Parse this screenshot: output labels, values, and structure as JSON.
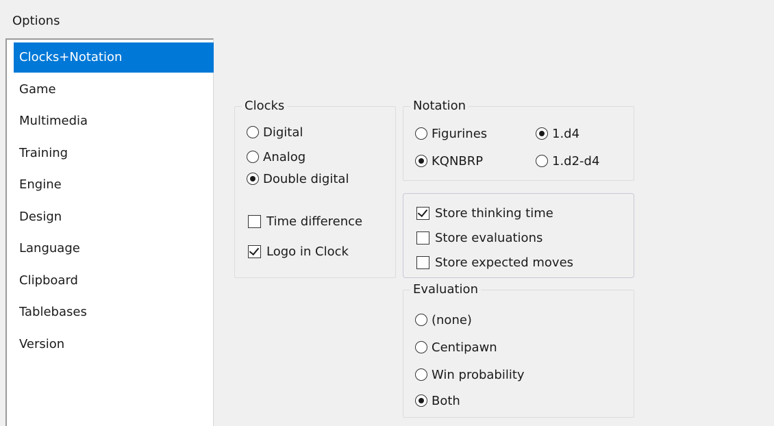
{
  "window": {
    "title": "Options"
  },
  "sidebar": {
    "items": [
      {
        "label": "Clocks+Notation",
        "selected": true
      },
      {
        "label": "Game",
        "selected": false
      },
      {
        "label": "Multimedia",
        "selected": false
      },
      {
        "label": "Training",
        "selected": false
      },
      {
        "label": "Engine",
        "selected": false
      },
      {
        "label": "Design",
        "selected": false
      },
      {
        "label": "Language",
        "selected": false
      },
      {
        "label": "Clipboard",
        "selected": false
      },
      {
        "label": "Tablebases",
        "selected": false
      },
      {
        "label": "Version",
        "selected": false
      }
    ]
  },
  "clocks": {
    "legend": "Clocks",
    "digital": {
      "label": "Digital",
      "checked": false
    },
    "analog": {
      "label": "Analog",
      "checked": false
    },
    "double_digital": {
      "label": "Double digital",
      "checked": true
    },
    "time_difference": {
      "label": "Time difference",
      "checked": false
    },
    "logo_in_clock": {
      "label": "Logo in Clock",
      "checked": true
    }
  },
  "notation": {
    "legend": "Notation",
    "figurines": {
      "label": "Figurines",
      "checked": false
    },
    "kqnbrp": {
      "label": "KQNBRP",
      "checked": true
    },
    "short": {
      "label": "1.d4",
      "checked": true
    },
    "long": {
      "label": "1.d2-d4",
      "checked": false
    }
  },
  "storage": {
    "thinking_time": {
      "label": "Store thinking time",
      "checked": true
    },
    "evaluations": {
      "label": "Store evaluations",
      "checked": false
    },
    "expected_moves": {
      "label": "Store expected moves",
      "checked": false
    }
  },
  "evaluation": {
    "legend": "Evaluation",
    "none": {
      "label": "(none)",
      "checked": false
    },
    "centipawn": {
      "label": "Centipawn",
      "checked": false
    },
    "win_probability": {
      "label": "Win probability",
      "checked": false
    },
    "both": {
      "label": "Both",
      "checked": true
    }
  },
  "colors": {
    "selection": "#0078d7",
    "window_bg": "#f0f0f0"
  }
}
